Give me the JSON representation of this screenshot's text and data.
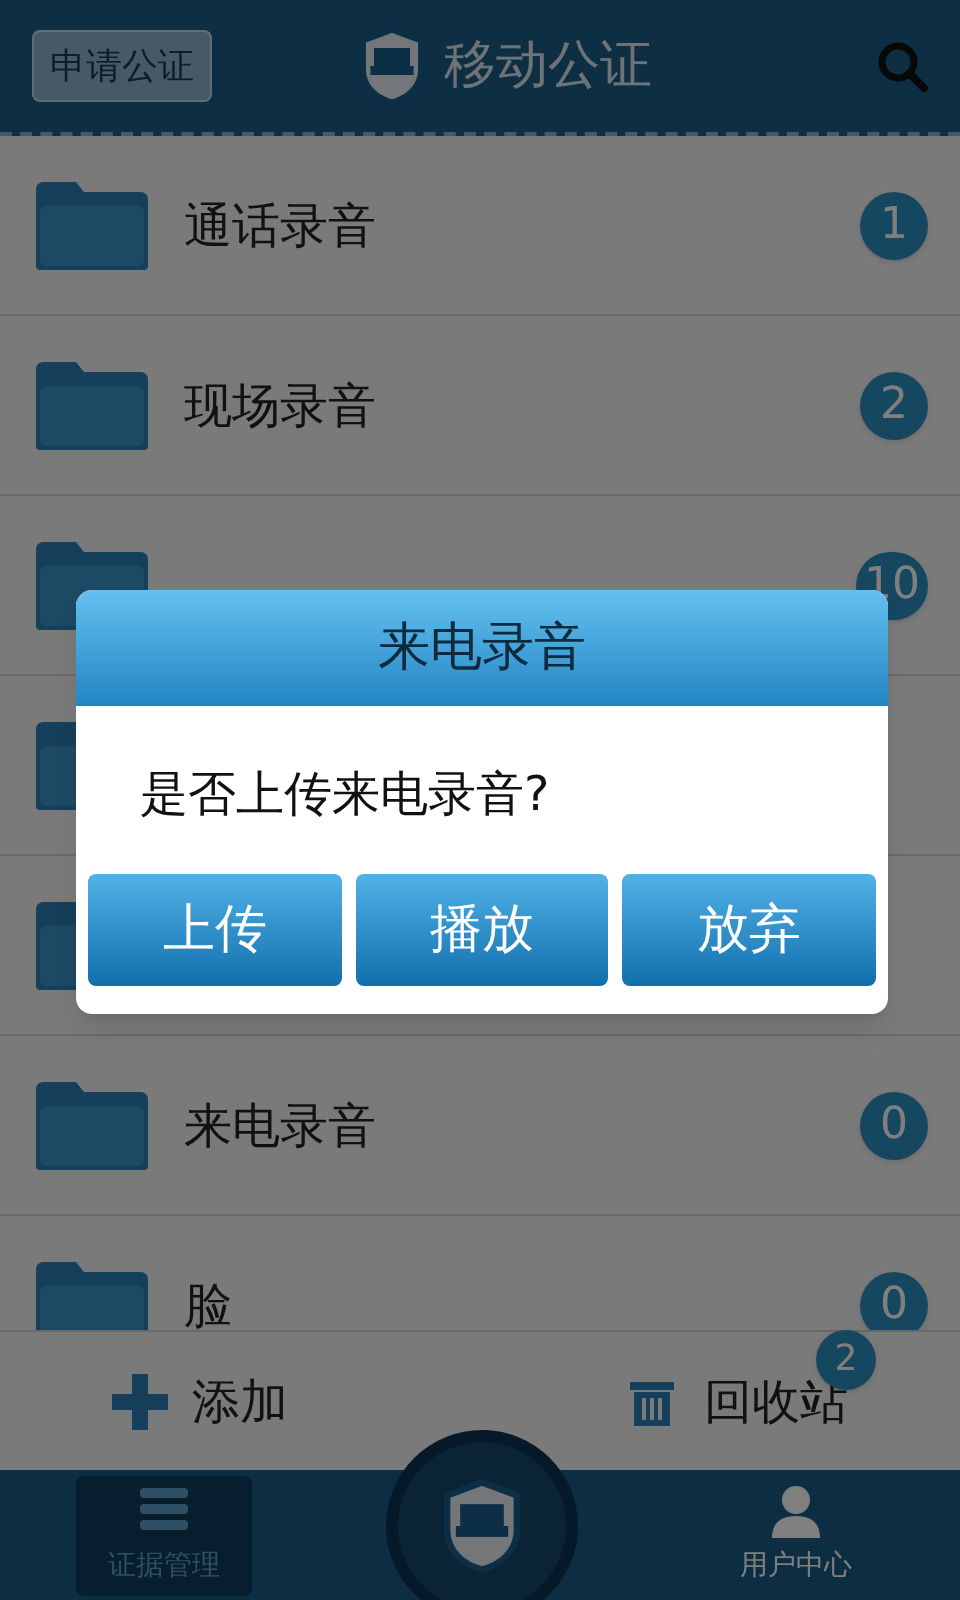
{
  "header": {
    "apply_button": "申请公证",
    "title": "移动公证"
  },
  "folders": [
    {
      "kind": "folder",
      "name": "通话录音",
      "count": "1"
    },
    {
      "kind": "folder",
      "name": "现场录音",
      "count": "2"
    },
    {
      "kind": "folder",
      "count": "10"
    },
    {
      "kind": "folder"
    },
    {
      "kind": "folder"
    },
    {
      "kind": "folder",
      "name": "来电录音",
      "count": "0"
    },
    {
      "kind": "folder",
      "name": "脸",
      "count": "0"
    }
  ],
  "actions": [
    {
      "kind": "add",
      "label": "添加"
    },
    {
      "kind": "trash",
      "label": "回收站",
      "badge": "2"
    }
  ],
  "tabs": [
    {
      "label": "证据管理",
      "selected": true
    },
    {
      "label": "用户中心",
      "selected": false
    }
  ],
  "dialog": {
    "title": "来电录音",
    "message": "是否上传来电录音?",
    "buttons": [
      "上传",
      "播放",
      "放弃"
    ]
  }
}
